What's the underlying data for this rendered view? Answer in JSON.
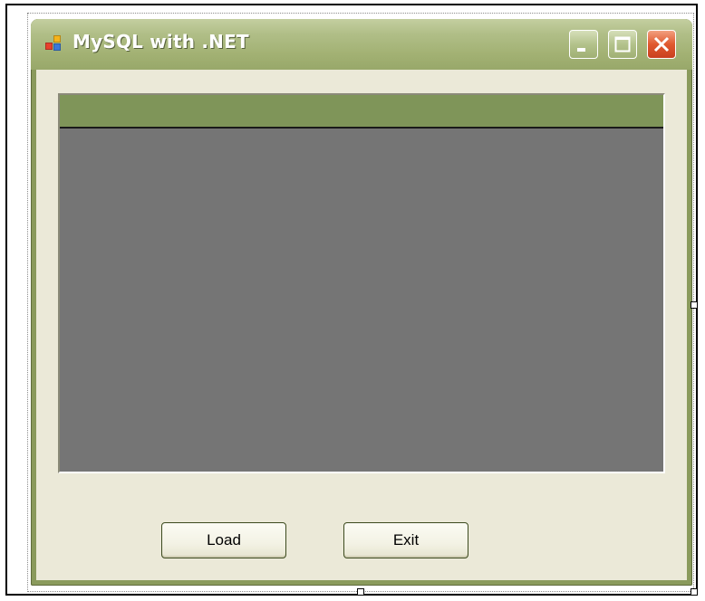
{
  "window": {
    "title": "MySQL with .NET",
    "icon": "winforms-app-icon",
    "controls": {
      "minimize": "minimize-icon",
      "maximize": "maximize-icon",
      "close": "close-icon"
    }
  },
  "grid": {
    "header_color": "#7f9559",
    "body_color": "#757575",
    "columns": [],
    "rows": []
  },
  "buttons": {
    "load_label": "Load",
    "exit_label": "Exit"
  },
  "colors": {
    "frame_accent": "#8a9a5c",
    "close_button": "#e0592f",
    "client_background": "#ebe9d8"
  }
}
